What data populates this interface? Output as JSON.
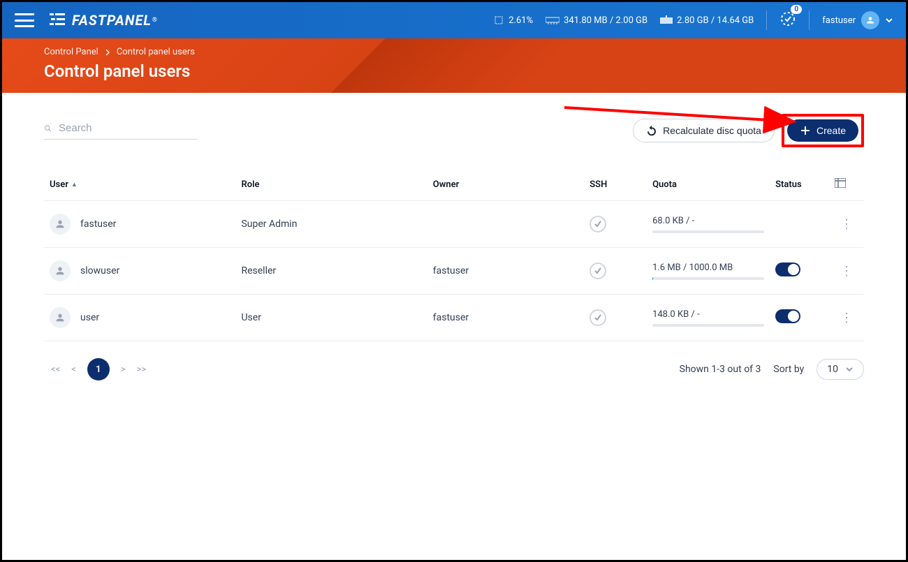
{
  "topbar": {
    "logo_text": "FASTPANEL",
    "logo_mark": "®",
    "stats": {
      "cpu": "2.61%",
      "ram": "341.80 MB / 2.00 GB",
      "disk": "2.80 GB / 14.64 GB"
    },
    "notifications": "0",
    "username": "fastuser"
  },
  "breadcrumb": {
    "root": "Control Panel",
    "current": "Control panel users"
  },
  "page_title": "Control panel users",
  "search": {
    "placeholder": "Search"
  },
  "actions": {
    "recalculate": "Recalculate disc quota",
    "create": "Create"
  },
  "table": {
    "headers": {
      "user": "User",
      "role": "Role",
      "owner": "Owner",
      "ssh": "SSH",
      "quota": "Quota",
      "status": "Status"
    },
    "rows": [
      {
        "user": "fastuser",
        "role": "Super Admin",
        "owner": "",
        "ssh": true,
        "quota_text": "68.0 KB / -",
        "quota_pct": 0,
        "status_toggle": null
      },
      {
        "user": "slowuser",
        "role": "Reseller",
        "owner": "fastuser",
        "ssh": true,
        "quota_text": "1.6 MB / 1000.0 MB",
        "quota_pct": 0.2,
        "status_toggle": true
      },
      {
        "user": "user",
        "role": "User",
        "owner": "fastuser",
        "ssh": true,
        "quota_text": "148.0 KB / -",
        "quota_pct": 0,
        "status_toggle": true
      }
    ]
  },
  "footer": {
    "page_current": "1",
    "shown_text": "Shown 1-3 out of 3",
    "sort_by_label": "Sort by",
    "sort_value": "10"
  }
}
